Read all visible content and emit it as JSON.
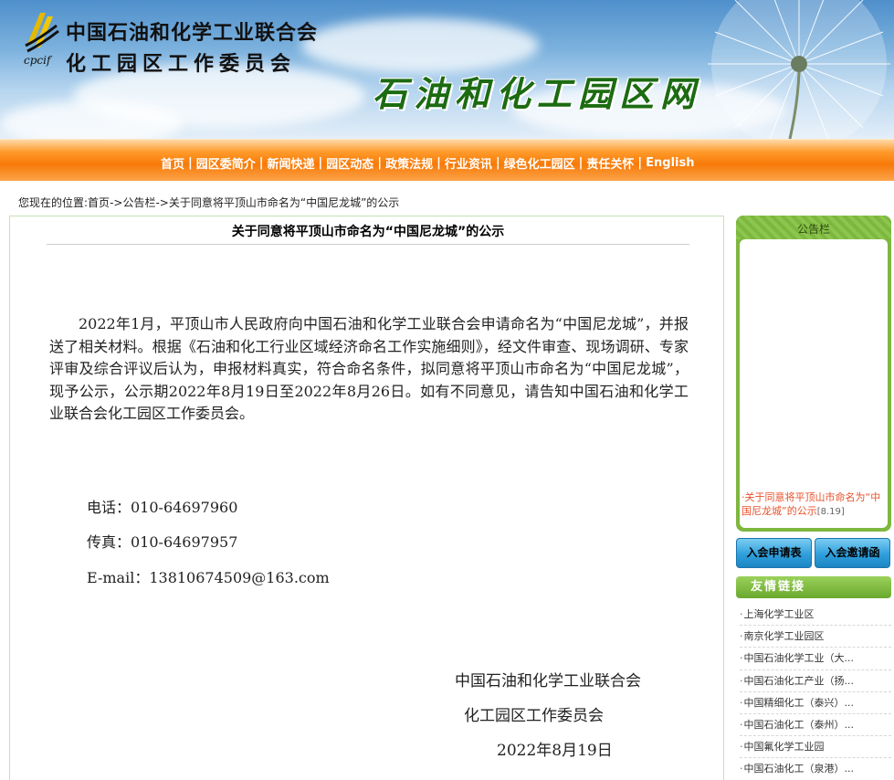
{
  "header": {
    "org_abbr": "cpcif",
    "org_name_line1": "中国石油和化学工业联合会",
    "org_name_line2": "化工园区工作委员会",
    "site_title": "石油和化工园区网"
  },
  "nav": {
    "items": [
      "首页",
      "园区委简介",
      "新闻快递",
      "园区动态",
      "政策法规",
      "行业资讯",
      "绿色化工园区",
      "责任关怀",
      "English"
    ]
  },
  "breadcrumb": {
    "prefix": "您现在的位置:",
    "home": "首页",
    "sep": "->",
    "section": "公告栏",
    "current": "关于同意将平顶山市命名为“中国尼龙城”的公示"
  },
  "article": {
    "title": "关于同意将平顶山市命名为“中国尼龙城”的公示",
    "body": "2022年1月，平顶山市人民政府向中国石油和化学工业联合会申请命名为“中国尼龙城”，并报送了相关材料。根据《石油和化工行业区域经济命名工作实施细则》，经文件审查、现场调研、专家评审及综合评议后认为，申报材料真实，符合命名条件，拟同意将平顶山市命名为“中国尼龙城”，现予公示，公示期2022年8月19日至2022年8月26日。如有不同意见，请告知中国石油和化学工业联合会化工园区工作委员会。",
    "phone": "电话：010-64697960",
    "fax": "传真：010-64697957",
    "email": "E-mail：13810674509@163.com",
    "sign_org1": "中国石油和化学工业联合会",
    "sign_org2": "化工园区工作委员会",
    "sign_date": "2022年8月19日"
  },
  "sidebar": {
    "notice_title": "公告栏",
    "notice_item": "·关于同意将平顶山市命名为“中国尼龙城”的公示",
    "notice_date": "[8.19]",
    "btn_apply": "入会申请表",
    "btn_invite": "入会邀请函",
    "links_title": "友情链接",
    "links": [
      "上海化学工业区",
      "南京化学工业园区",
      "中国石油化学工业（大...",
      "中国石油化工产业（扬...",
      "中国精细化工（泰兴）...",
      "中国石油化工（泰州）...",
      "中国氟化学工业园",
      "中国石油化工（泉港）..."
    ]
  },
  "colors": {
    "nav_orange": "#f77a08",
    "title_green": "#1c6b12",
    "sidebar_green": "#7db73f",
    "button_blue": "#2f9fdc",
    "notice_link": "#e8512a"
  }
}
